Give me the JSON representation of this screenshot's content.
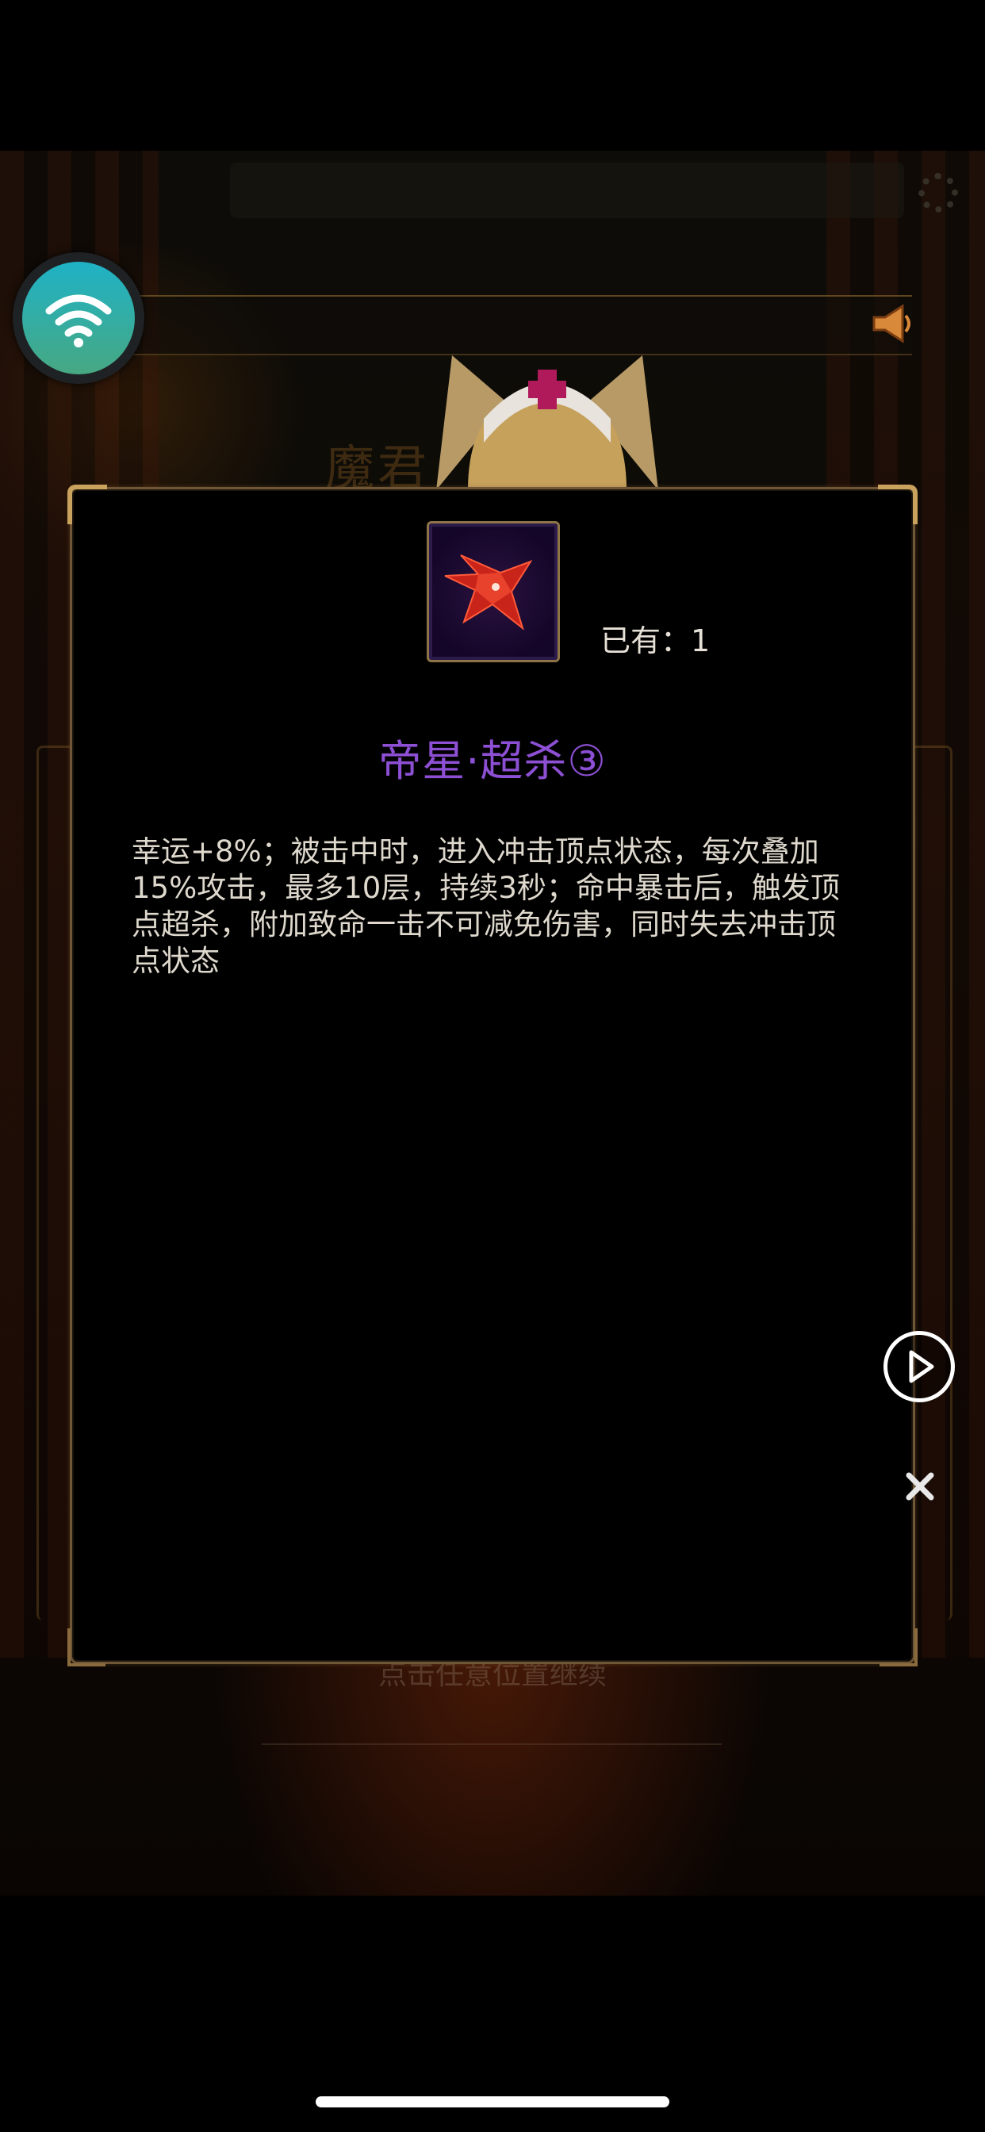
{
  "background": {
    "title_text": "魔君",
    "continue_hint": "点击任意位置继续"
  },
  "item": {
    "owned_label": "已有：1",
    "name": "帝星·超杀③",
    "name_color": "#8d4fd3",
    "icon": "red-star-gem-icon",
    "description": "幸运+8%；被击中时，进入冲击顶点状态，每次叠加15%攻击，最多10层，持续3秒；命中暴击后，触发顶点超杀，附加致命一击不可减免伤害，同时失去冲击顶点状态"
  },
  "controls": {
    "wifi_icon": "wifi-icon",
    "speaker_icon": "speaker-icon",
    "settings_icon": "gear-icon",
    "play_icon": "play-icon",
    "close_icon": "close-icon"
  },
  "colors": {
    "frame_gold": "#c9a25e",
    "wifi_gradient_top": "#1fb2c6",
    "wifi_gradient_bottom": "#47a882",
    "text": "#ded8cd"
  }
}
